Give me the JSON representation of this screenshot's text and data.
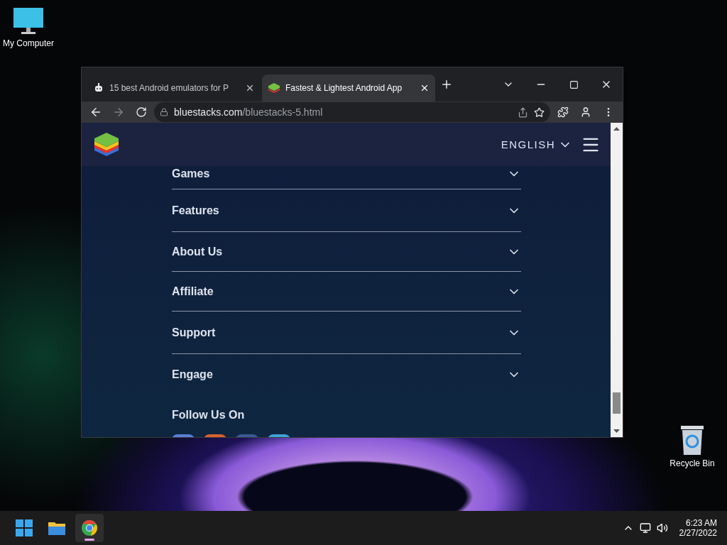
{
  "desktop_icons": [
    {
      "kind": "computer",
      "label": "My Computer"
    },
    {
      "kind": "recycle",
      "label": "Recycle Bin"
    }
  ],
  "browser": {
    "tabs": [
      {
        "title": "15 best Android emulators for P",
        "selected": false
      },
      {
        "title": "Fastest & Lightest Android App",
        "selected": true
      }
    ],
    "url": {
      "domain": "bluestacks.com",
      "path": "/bluestacks-5.html"
    }
  },
  "page": {
    "language": "ENGLISH",
    "footer_sections": [
      {
        "title": "Games",
        "expanded": false
      },
      {
        "title": "Features",
        "expanded": false
      },
      {
        "title": "About Us",
        "expanded": false
      },
      {
        "title": "Affiliate",
        "expanded": false
      },
      {
        "title": "Support",
        "expanded": false
      },
      {
        "title": "Engage",
        "expanded": false
      }
    ],
    "follow_heading": "Follow Us On",
    "social_icons": [
      {
        "color": "#5b7fd6"
      },
      {
        "color": "#d9622e"
      },
      {
        "color": "#3b5a94"
      },
      {
        "color": "#3fa3d8"
      }
    ]
  },
  "taskbar": {
    "apps": [
      {
        "kind": "start",
        "selected": false
      },
      {
        "kind": "explorer",
        "selected": false
      },
      {
        "kind": "chrome",
        "selected": true
      }
    ],
    "time": "6:23 AM",
    "date": "2/27/2022"
  }
}
